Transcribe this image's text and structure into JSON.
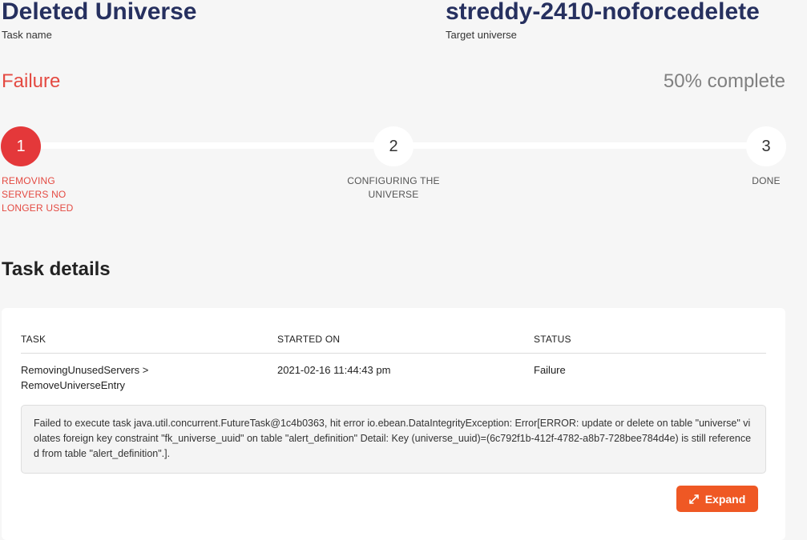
{
  "header": {
    "task_name": "Deleted Universe",
    "task_name_label": "Task name",
    "target_universe": "streddy-2410-noforcedelete",
    "target_universe_label": "Target universe",
    "status": "Failure",
    "progress_text": "50% complete",
    "progress": 0.5
  },
  "steps": [
    {
      "number": "1",
      "label": "REMOVING SERVERS NO LONGER USED",
      "state": "failed"
    },
    {
      "number": "2",
      "label": "CONFIGURING THE UNIVERSE",
      "state": "pending"
    },
    {
      "number": "3",
      "label": "DONE",
      "state": "pending"
    }
  ],
  "details": {
    "title": "Task details",
    "columns": [
      "TASK",
      "STARTED ON",
      "STATUS"
    ],
    "row": {
      "task": "RemovingUnusedServers > RemoveUniverseEntry",
      "started_on": "2021-02-16 11:44:43 pm",
      "status": "Failure"
    },
    "error_message": "Failed to execute task java.util.concurrent.FutureTask@1c4b0363, hit error io.ebean.DataIntegrityException: Error[ERROR: update or delete on table \"universe\" violates foreign key constraint \"fk_universe_uuid\" on table \"alert_definition\"   Detail: Key (universe_uuid)=(6c792f1b-412f-4782-a8b7-728bee784d4e) is still referenced from table \"alert_definition\".].",
    "expand_label": "Expand"
  },
  "colors": {
    "title": "#26305f",
    "failure": "#e44a42",
    "accent": "#ef5824"
  },
  "icons": {
    "expand": "expand-arrows-icon"
  }
}
